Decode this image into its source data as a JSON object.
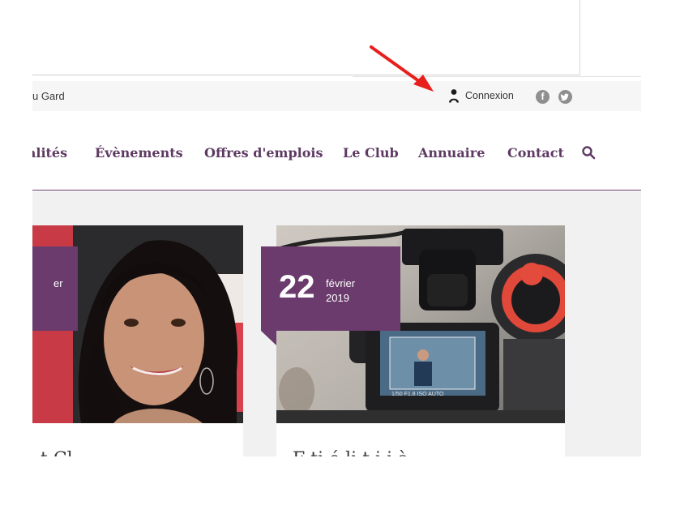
{
  "topbar": {
    "region_partial": "u Gard",
    "login_label": "Connexion",
    "social": [
      {
        "icon": "facebook-icon",
        "glyph": "f"
      },
      {
        "icon": "twitter-icon",
        "glyph": "t"
      }
    ]
  },
  "nav": {
    "items": [
      {
        "label": "alités"
      },
      {
        "label": "Évènements"
      },
      {
        "label": "Offres d'emplois"
      },
      {
        "label": "Le Club"
      },
      {
        "label": "Annuaire"
      },
      {
        "label": "Contact"
      }
    ],
    "search_icon": "search-icon"
  },
  "cards": [
    {
      "date_month_partial": "er",
      "title_partial": "t       Cl"
    },
    {
      "date_day": "22",
      "date_month": "février",
      "date_year": "2019",
      "title_partial": "  F     ti       é li  t  i i   à"
    }
  ],
  "colors": {
    "brand_purple": "#6a3b6c",
    "nav_text": "#5e3a63",
    "annotation_arrow": "#e8201d"
  }
}
